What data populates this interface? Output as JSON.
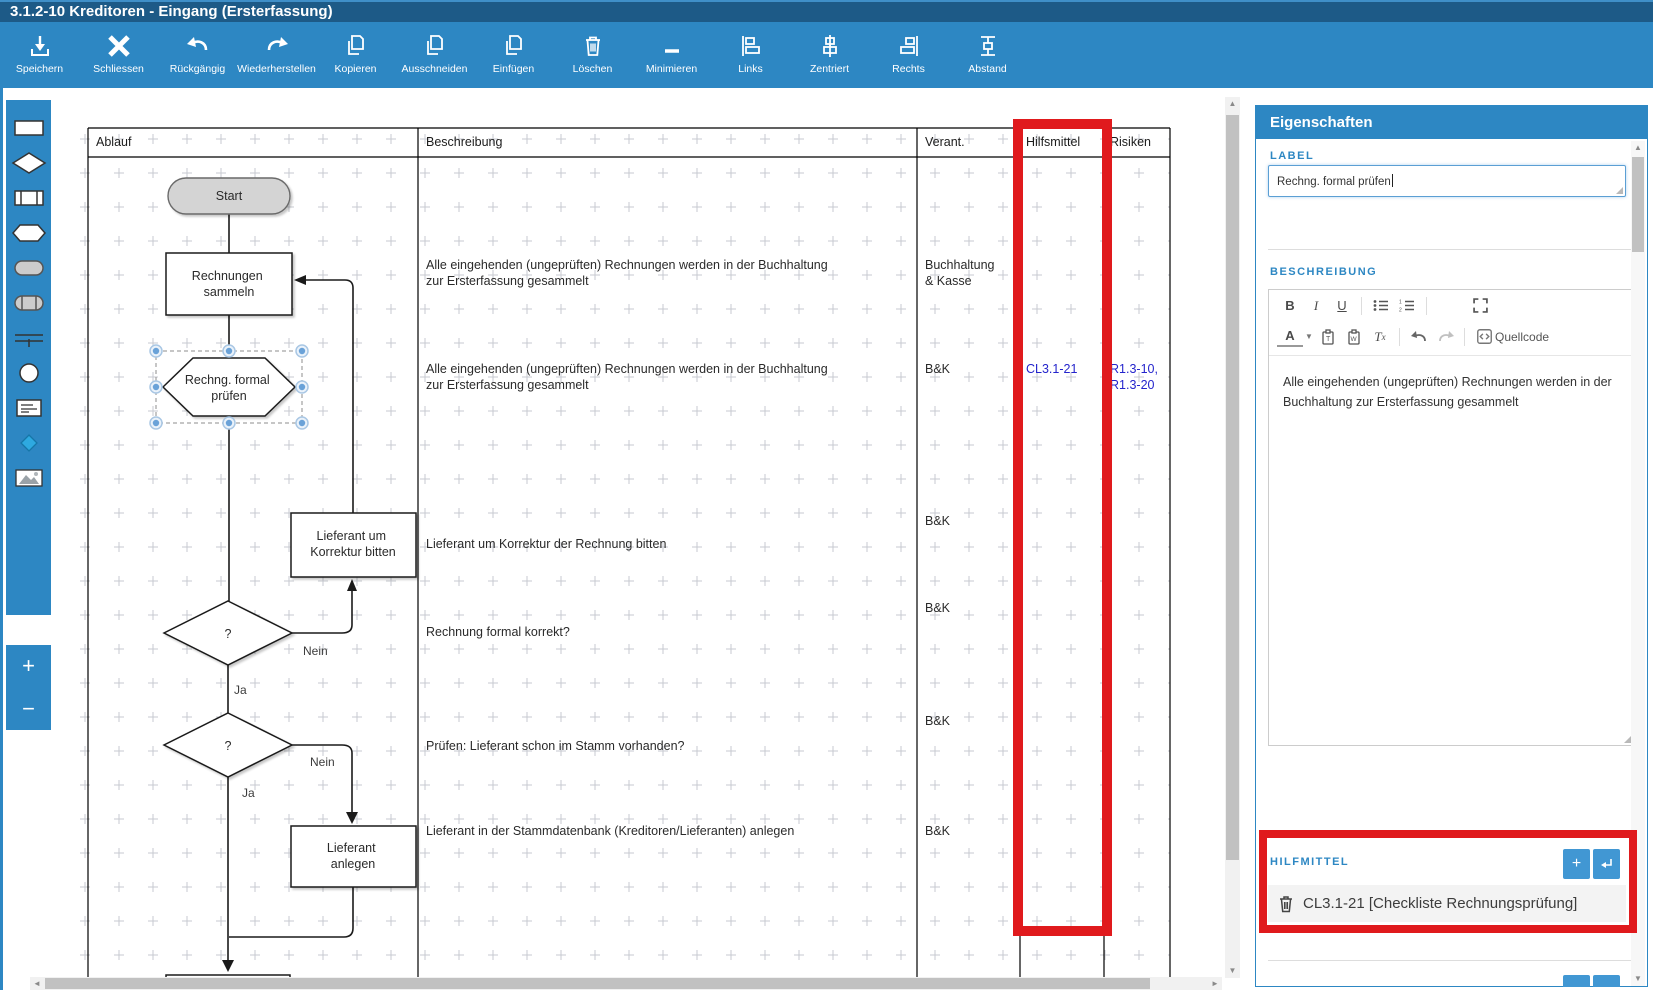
{
  "window": {
    "title": "3.1.2-10 Kreditoren - Eingang (Ersterfassung)"
  },
  "toolbar": {
    "buttons": [
      {
        "label": "Speichern",
        "icon": "save-download-icon"
      },
      {
        "label": "Schliessen",
        "icon": "close-x-icon"
      },
      {
        "label": "Rückgängig",
        "icon": "undo-icon"
      },
      {
        "label": "Wiederherstellen",
        "icon": "redo-icon"
      },
      {
        "label": "Kopieren",
        "icon": "copy-icon"
      },
      {
        "label": "Ausschneiden",
        "icon": "cut-icon"
      },
      {
        "label": "Einfügen",
        "icon": "paste-icon"
      },
      {
        "label": "Löschen",
        "icon": "trash-icon"
      },
      {
        "label": "Minimieren",
        "icon": "minimize-icon"
      },
      {
        "label": "Links",
        "icon": "align-left-icon"
      },
      {
        "label": "Zentriert",
        "icon": "align-center-icon"
      },
      {
        "label": "Rechts",
        "icon": "align-right-icon"
      },
      {
        "label": "Abstand",
        "icon": "spacing-icon"
      }
    ]
  },
  "palette": {
    "items": [
      "rectangle",
      "diamond",
      "process",
      "hexagon",
      "rounded-rectangle",
      "rounded-process",
      "parallel-lines",
      "circle",
      "note",
      "small-diamond",
      "image"
    ]
  },
  "zoom_controls": {
    "zoom_in": "+",
    "zoom_out": "−"
  },
  "canvas": {
    "columns": [
      "Ablauf",
      "Beschreibung",
      "Verant.",
      "Hilfsmittel",
      "Risiken"
    ],
    "nodes": {
      "start": "Start",
      "collect": [
        "Rechnungen",
        "sammeln"
      ],
      "check": [
        "Rechng. formal",
        "prüfen"
      ],
      "decision1": "?",
      "correct": [
        "Lieferant um",
        "Korrektur bitten"
      ],
      "decision2": "?",
      "create": [
        "Lieferant",
        "anlegen"
      ]
    },
    "edge_labels": {
      "nein1": "Nein",
      "ja1": "Ja",
      "nein2": "Nein",
      "ja2": "Ja"
    },
    "rows": [
      {
        "desc": [
          "Alle eingehenden (ungeprüften) Rechnungen werden in der Buchhaltung",
          "zur Ersterfassung gesammelt"
        ],
        "verant": [
          "Buchhaltung",
          "& Kasse"
        ],
        "hilfsmittel": "",
        "risiken": [
          "",
          ""
        ]
      },
      {
        "desc": [
          "Alle eingehenden (ungeprüften) Rechnungen werden in der Buchhaltung",
          "zur Ersterfassung gesammelt"
        ],
        "verant": [
          "B&K"
        ],
        "hilfsmittel": "CL3.1-21",
        "risiken": [
          "R1.3-10,",
          "R1.3-20"
        ]
      },
      {
        "desc": [
          "Lieferant um Korrektur der Rechnung bitten"
        ],
        "verant": [
          "B&K"
        ]
      },
      {
        "desc": [
          "Rechnung formal korrekt?"
        ],
        "verant": [
          "B&K"
        ]
      },
      {
        "desc": [
          "Prüfen: Lieferant schon im Stamm vorhanden?"
        ],
        "verant": [
          "B&K"
        ]
      },
      {
        "desc": [
          "Lieferant in der Stammdatenbank (Kreditoren/Lieferanten) anlegen"
        ],
        "verant": [
          "B&K"
        ]
      }
    ]
  },
  "properties_panel": {
    "title": "Eigenschaften",
    "label_section": "LABEL",
    "label_value": "Rechng. formal prüfen",
    "description_section": "BESCHREIBUNG",
    "editor": {
      "bold": "B",
      "italic": "I",
      "underline": "U",
      "color_letter": "A",
      "remove_format_letter": "T",
      "source": "Quellcode",
      "content": "Alle eingehenden (ungeprüften) Rechnungen werden in der Buchhaltung zur Ersterfassung gesammelt"
    },
    "hilfmittel": {
      "label": "HILFMITTEL",
      "add_button": "+",
      "item": "CL3.1-21 [Checkliste Rechnungsprüfung]"
    }
  },
  "colors": {
    "accent_blue": "#2d87c3",
    "titlebar_blue": "#1d5a87",
    "annotation_red": "#e01a1d",
    "link_blue": "#2424cc"
  }
}
